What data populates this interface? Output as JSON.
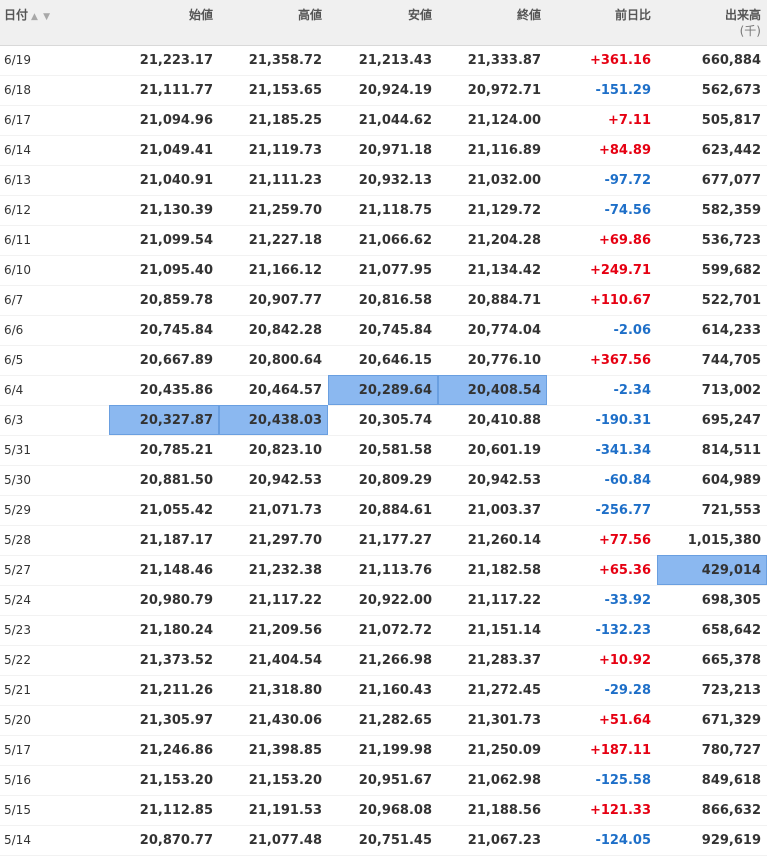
{
  "table": {
    "headers": [
      "日付",
      "始値",
      "高値",
      "安値",
      "終値",
      "前日比",
      "出来高"
    ],
    "volume_unit": "(千)",
    "up_color": "#e60012",
    "down_color": "#1e6fc8",
    "highlight_color": "#8bb8f0",
    "rows": [
      {
        "date": "6/19",
        "open": "21,223.17",
        "high": "21,358.72",
        "low": "21,213.43",
        "close": "21,333.87",
        "change": "+361.16",
        "volume": "660,884"
      },
      {
        "date": "6/18",
        "open": "21,111.77",
        "high": "21,153.65",
        "low": "20,924.19",
        "close": "20,972.71",
        "change": "-151.29",
        "volume": "562,673"
      },
      {
        "date": "6/17",
        "open": "21,094.96",
        "high": "21,185.25",
        "low": "21,044.62",
        "close": "21,124.00",
        "change": "+7.11",
        "volume": "505,817"
      },
      {
        "date": "6/14",
        "open": "21,049.41",
        "high": "21,119.73",
        "low": "20,971.18",
        "close": "21,116.89",
        "change": "+84.89",
        "volume": "623,442"
      },
      {
        "date": "6/13",
        "open": "21,040.91",
        "high": "21,111.23",
        "low": "20,932.13",
        "close": "21,032.00",
        "change": "-97.72",
        "volume": "677,077"
      },
      {
        "date": "6/12",
        "open": "21,130.39",
        "high": "21,259.70",
        "low": "21,118.75",
        "close": "21,129.72",
        "change": "-74.56",
        "volume": "582,359"
      },
      {
        "date": "6/11",
        "open": "21,099.54",
        "high": "21,227.18",
        "low": "21,066.62",
        "close": "21,204.28",
        "change": "+69.86",
        "volume": "536,723"
      },
      {
        "date": "6/10",
        "open": "21,095.40",
        "high": "21,166.12",
        "low": "21,077.95",
        "close": "21,134.42",
        "change": "+249.71",
        "volume": "599,682"
      },
      {
        "date": "6/7",
        "open": "20,859.78",
        "high": "20,907.77",
        "low": "20,816.58",
        "close": "20,884.71",
        "change": "+110.67",
        "volume": "522,701"
      },
      {
        "date": "6/6",
        "open": "20,745.84",
        "high": "20,842.28",
        "low": "20,745.84",
        "close": "20,774.04",
        "change": "-2.06",
        "volume": "614,233"
      },
      {
        "date": "6/5",
        "open": "20,667.89",
        "high": "20,800.64",
        "low": "20,646.15",
        "close": "20,776.10",
        "change": "+367.56",
        "volume": "744,705"
      },
      {
        "date": "6/4",
        "open": "20,435.86",
        "high": "20,464.57",
        "low": "20,289.64",
        "close": "20,408.54",
        "change": "-2.34",
        "volume": "713,002"
      },
      {
        "date": "6/3",
        "open": "20,327.87",
        "high": "20,438.03",
        "low": "20,305.74",
        "close": "20,410.88",
        "change": "-190.31",
        "volume": "695,247"
      },
      {
        "date": "5/31",
        "open": "20,785.21",
        "high": "20,823.10",
        "low": "20,581.58",
        "close": "20,601.19",
        "change": "-341.34",
        "volume": "814,511"
      },
      {
        "date": "5/30",
        "open": "20,881.50",
        "high": "20,942.53",
        "low": "20,809.29",
        "close": "20,942.53",
        "change": "-60.84",
        "volume": "604,989"
      },
      {
        "date": "5/29",
        "open": "21,055.42",
        "high": "21,071.73",
        "low": "20,884.61",
        "close": "21,003.37",
        "change": "-256.77",
        "volume": "721,553"
      },
      {
        "date": "5/28",
        "open": "21,187.17",
        "high": "21,297.70",
        "low": "21,177.27",
        "close": "21,260.14",
        "change": "+77.56",
        "volume": "1,015,380"
      },
      {
        "date": "5/27",
        "open": "21,148.46",
        "high": "21,232.38",
        "low": "21,113.76",
        "close": "21,182.58",
        "change": "+65.36",
        "volume": "429,014"
      },
      {
        "date": "5/24",
        "open": "20,980.79",
        "high": "21,117.22",
        "low": "20,922.00",
        "close": "21,117.22",
        "change": "-33.92",
        "volume": "698,305"
      },
      {
        "date": "5/23",
        "open": "21,180.24",
        "high": "21,209.56",
        "low": "21,072.72",
        "close": "21,151.14",
        "change": "-132.23",
        "volume": "658,642"
      },
      {
        "date": "5/22",
        "open": "21,373.52",
        "high": "21,404.54",
        "low": "21,266.98",
        "close": "21,283.37",
        "change": "+10.92",
        "volume": "665,378"
      },
      {
        "date": "5/21",
        "open": "21,211.26",
        "high": "21,318.80",
        "low": "21,160.43",
        "close": "21,272.45",
        "change": "-29.28",
        "volume": "723,213"
      },
      {
        "date": "5/20",
        "open": "21,305.97",
        "high": "21,430.06",
        "low": "21,282.65",
        "close": "21,301.73",
        "change": "+51.64",
        "volume": "671,329"
      },
      {
        "date": "5/17",
        "open": "21,246.86",
        "high": "21,398.85",
        "low": "21,199.98",
        "close": "21,250.09",
        "change": "+187.11",
        "volume": "780,727"
      },
      {
        "date": "5/16",
        "open": "21,153.20",
        "high": "21,153.20",
        "low": "20,951.67",
        "close": "21,062.98",
        "change": "-125.58",
        "volume": "849,618"
      },
      {
        "date": "5/15",
        "open": "21,112.85",
        "high": "21,191.53",
        "low": "20,968.08",
        "close": "21,188.56",
        "change": "+121.33",
        "volume": "866,632"
      },
      {
        "date": "5/14",
        "open": "20,870.77",
        "high": "21,077.48",
        "low": "20,751.45",
        "close": "21,067.23",
        "change": "-124.05",
        "volume": "929,619"
      }
    ],
    "highlighted_cells": [
      {
        "row": 11,
        "field": "low"
      },
      {
        "row": 11,
        "field": "close"
      },
      {
        "row": 12,
        "field": "open"
      },
      {
        "row": 12,
        "field": "high"
      },
      {
        "row": 17,
        "field": "volume"
      }
    ]
  }
}
